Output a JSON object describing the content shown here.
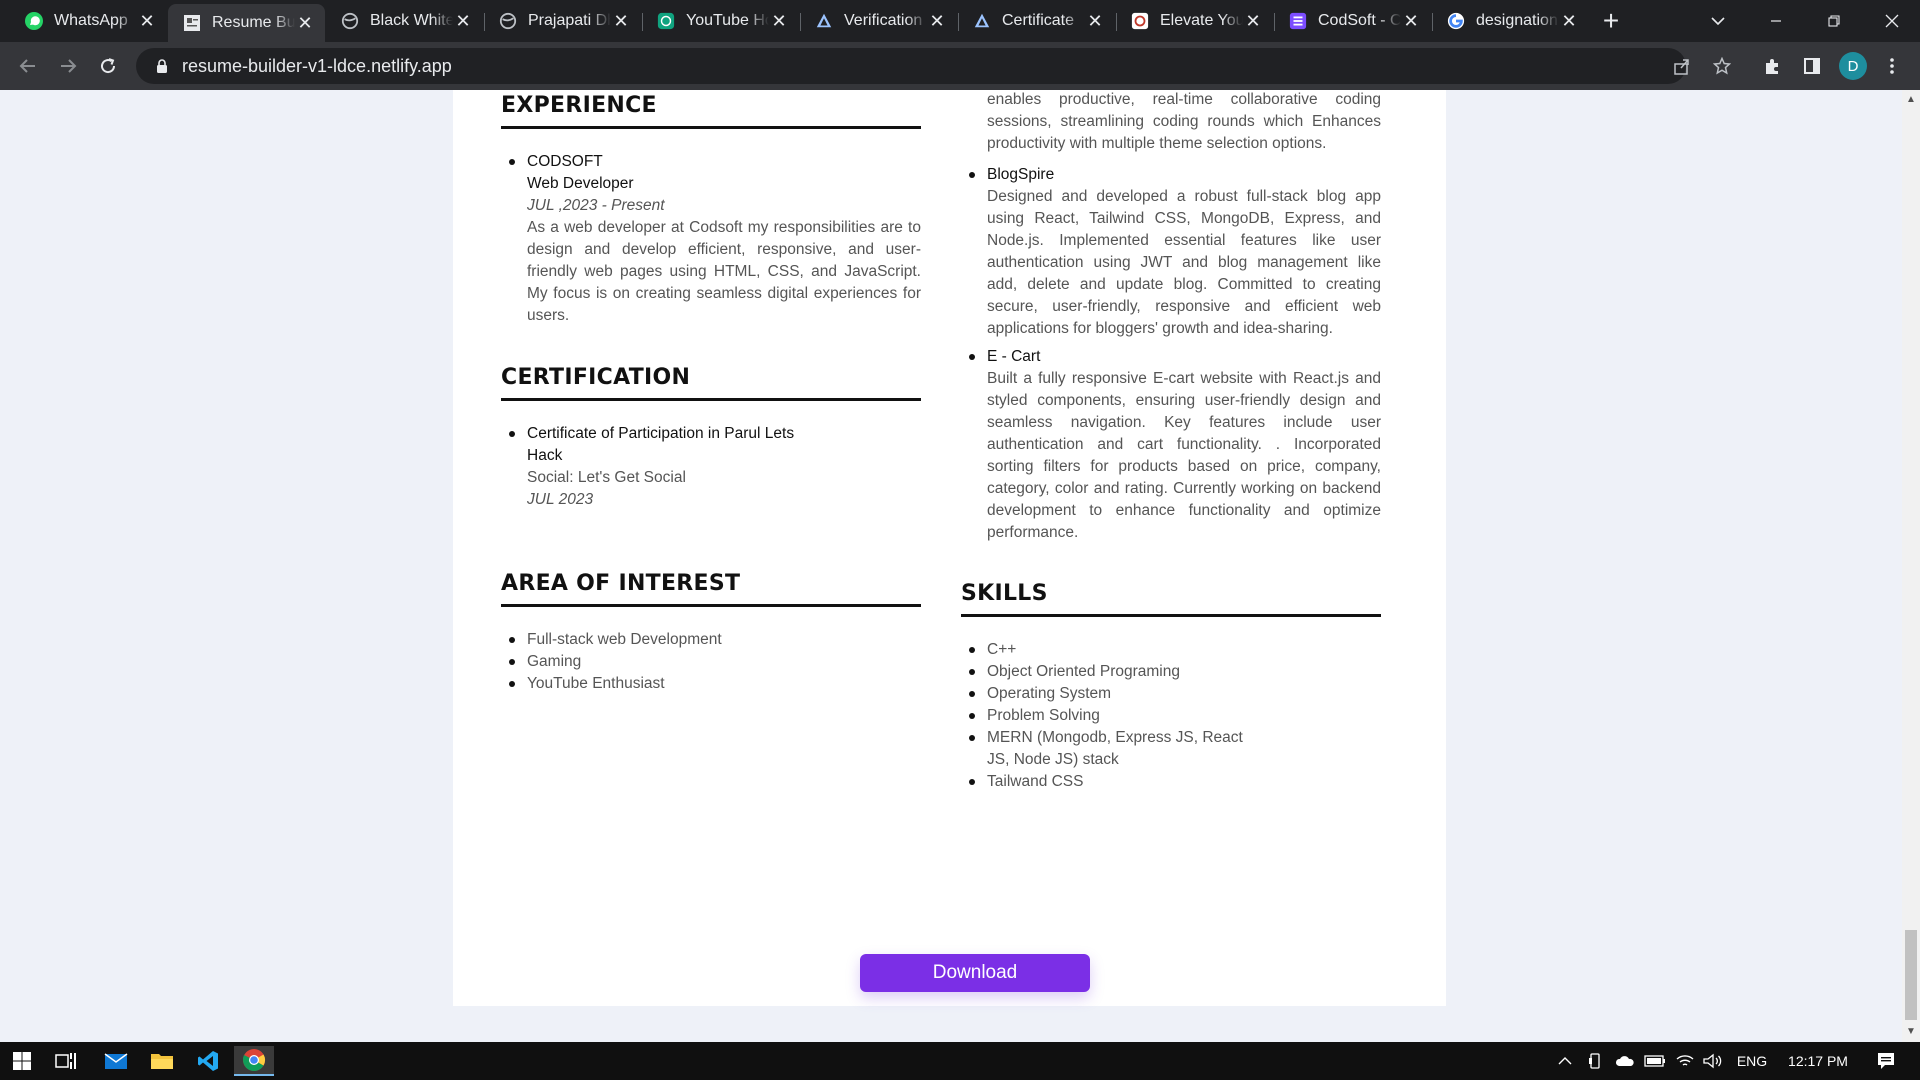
{
  "browser": {
    "tabs": [
      {
        "title": "WhatsApp",
        "icon": "whatsapp-icon",
        "active": false
      },
      {
        "title": "Resume Builder",
        "icon": "document-icon",
        "active": true
      },
      {
        "title": "Black White",
        "icon": "globe-icon",
        "active": false
      },
      {
        "title": "Prajapati Dhruv",
        "icon": "globe-icon",
        "active": false
      },
      {
        "title": "YouTube Home",
        "icon": "openai-icon",
        "active": false
      },
      {
        "title": "Verification",
        "icon": "vercel-icon",
        "active": false
      },
      {
        "title": "Certificate",
        "icon": "vercel-icon",
        "active": false
      },
      {
        "title": "Elevate Your",
        "icon": "app-icon",
        "active": false
      },
      {
        "title": "CodSoft - C",
        "icon": "list-icon",
        "active": false
      },
      {
        "title": "designation",
        "icon": "google-icon",
        "active": false
      }
    ],
    "url": "resume-builder-v1-ldce.netlify.app",
    "profile_initial": "D"
  },
  "resume": {
    "experience": {
      "heading": "EXPERIENCE",
      "items": [
        {
          "company": "CODSOFT",
          "role": "Web Developer",
          "period": "JUL ,2023  - Present",
          "description": "As a web developer at Codsoft my responsibilities are to design and develop efficient, responsive, and user-friendly web pages using HTML, CSS, and JavaScript. My focus is on creating seamless digital experiences for users."
        }
      ]
    },
    "certification": {
      "heading": "CERTIFICATION",
      "items": [
        {
          "title_line1": "Certificate of Participation in Parul Lets",
          "title_line2": "Hack",
          "subtitle": "Social: Let's Get Social",
          "date": "JUL 2023"
        }
      ]
    },
    "interest": {
      "heading": "AREA OF INTEREST",
      "items": [
        "Full-stack web Development",
        "Gaming",
        "YouTube Enthusiast"
      ]
    },
    "projects": {
      "cut_text": "enables productive, real-time collaborative coding sessions, streamlining coding rounds which Enhances productivity with multiple theme selection options.",
      "items": [
        {
          "name": "BlogSpire",
          "description": "Designed and developed a robust full-stack blog app using React, Tailwind CSS, MongoDB, Express, and Node.js. Implemented essential features like user authentication using JWT and blog management like add, delete and update blog. Committed to creating secure, user-friendly, responsive and efficient web applications for bloggers' growth and idea-sharing."
        },
        {
          "name": "E - Cart",
          "description": "Built a fully responsive E-cart website with React.js and styled components, ensuring user-friendly design and seamless navigation. Key features include user authentication and cart functionality. . Incorporated sorting filters for products based on price, company, category, color and rating. Currently working on backend development to enhance functionality and optimize performance."
        }
      ]
    },
    "skills": {
      "heading": "SKILLS",
      "items": [
        "C++",
        "Object Oriented Programing",
        "Operating System",
        "Problem Solving",
        "MERN (Mongodb, Express JS, React JS, Node JS) stack",
        "Tailwand CSS"
      ]
    }
  },
  "download_label": "Download",
  "taskbar": {
    "language": "ENG",
    "time": "12:17 PM"
  },
  "colors": {
    "accent": "#7b2fe6",
    "page_bg": "#eef1f8",
    "chrome_dark": "#202124"
  }
}
